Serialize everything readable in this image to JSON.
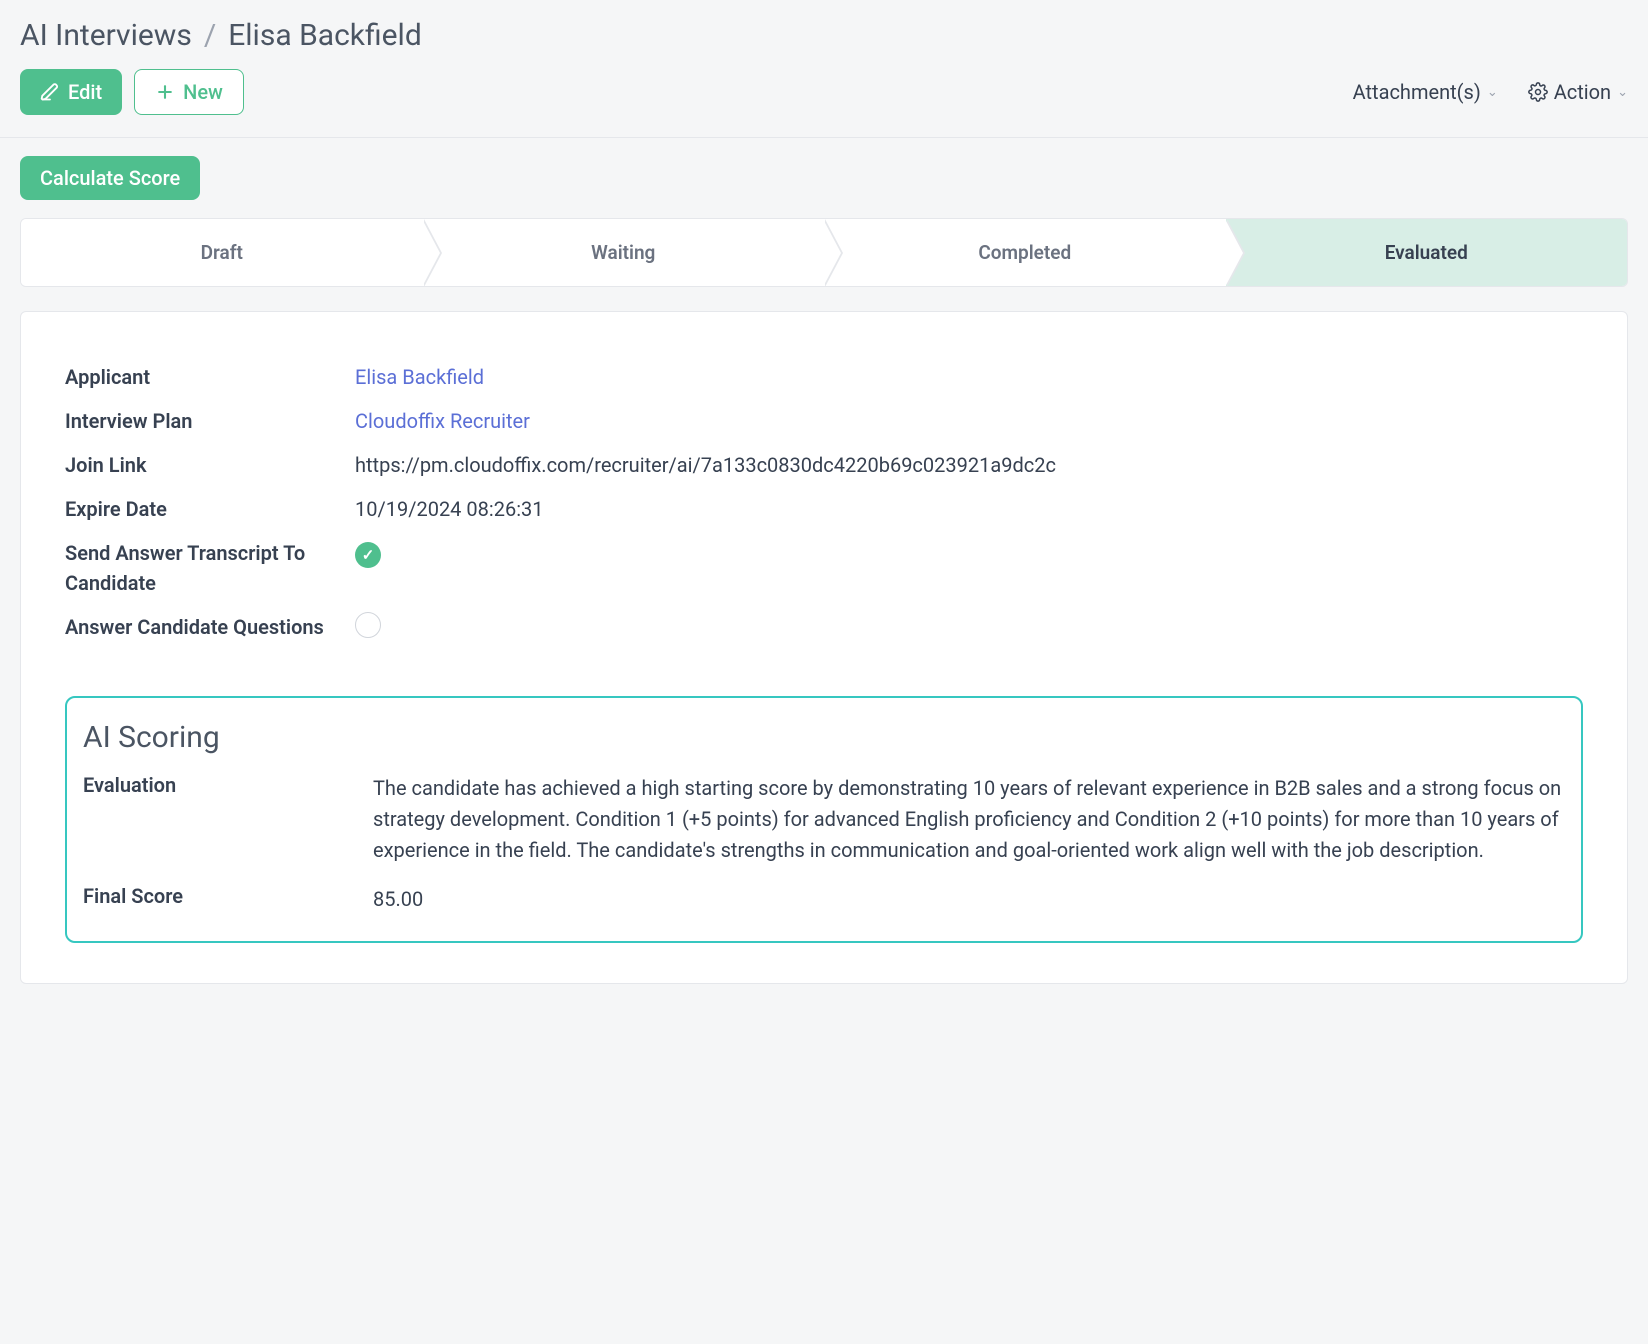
{
  "breadcrumb": {
    "root": "AI Interviews",
    "current": "Elisa Backfield"
  },
  "header": {
    "edit_label": "Edit",
    "new_label": "New",
    "attachments_label": "Attachment(s)",
    "action_label": "Action"
  },
  "toolbar": {
    "calculate_label": "Calculate Score"
  },
  "stages": {
    "s1": "Draft",
    "s2": "Waiting",
    "s3": "Completed",
    "s4": "Evaluated"
  },
  "fields": {
    "applicant_label": "Applicant",
    "applicant_value": "Elisa Backfield",
    "plan_label": "Interview Plan",
    "plan_value": "Cloudoffix Recruiter",
    "joinlink_label": "Join Link",
    "joinlink_value": "https://pm.cloudoffix.com/recruiter/ai/7a133c0830dc4220b69c023921a9dc2c",
    "expire_label": "Expire Date",
    "expire_value": "10/19/2024 08:26:31",
    "send_transcript_label": "Send Answer Transcript To Candidate",
    "answer_questions_label": "Answer Candidate Questions"
  },
  "scoring": {
    "title": "AI Scoring",
    "evaluation_label": "Evaluation",
    "evaluation_text": "The candidate has achieved a high starting score by demonstrating 10 years of relevant experience in B2B sales and a strong focus on strategy development. Condition 1 (+5 points) for advanced English proficiency and Condition 2 (+10 points) for more than 10 years of experience in the field. The candidate's strengths in communication and goal-oriented work align well with the job description.",
    "finalscore_label": "Final Score",
    "finalscore_value": "85.00"
  }
}
